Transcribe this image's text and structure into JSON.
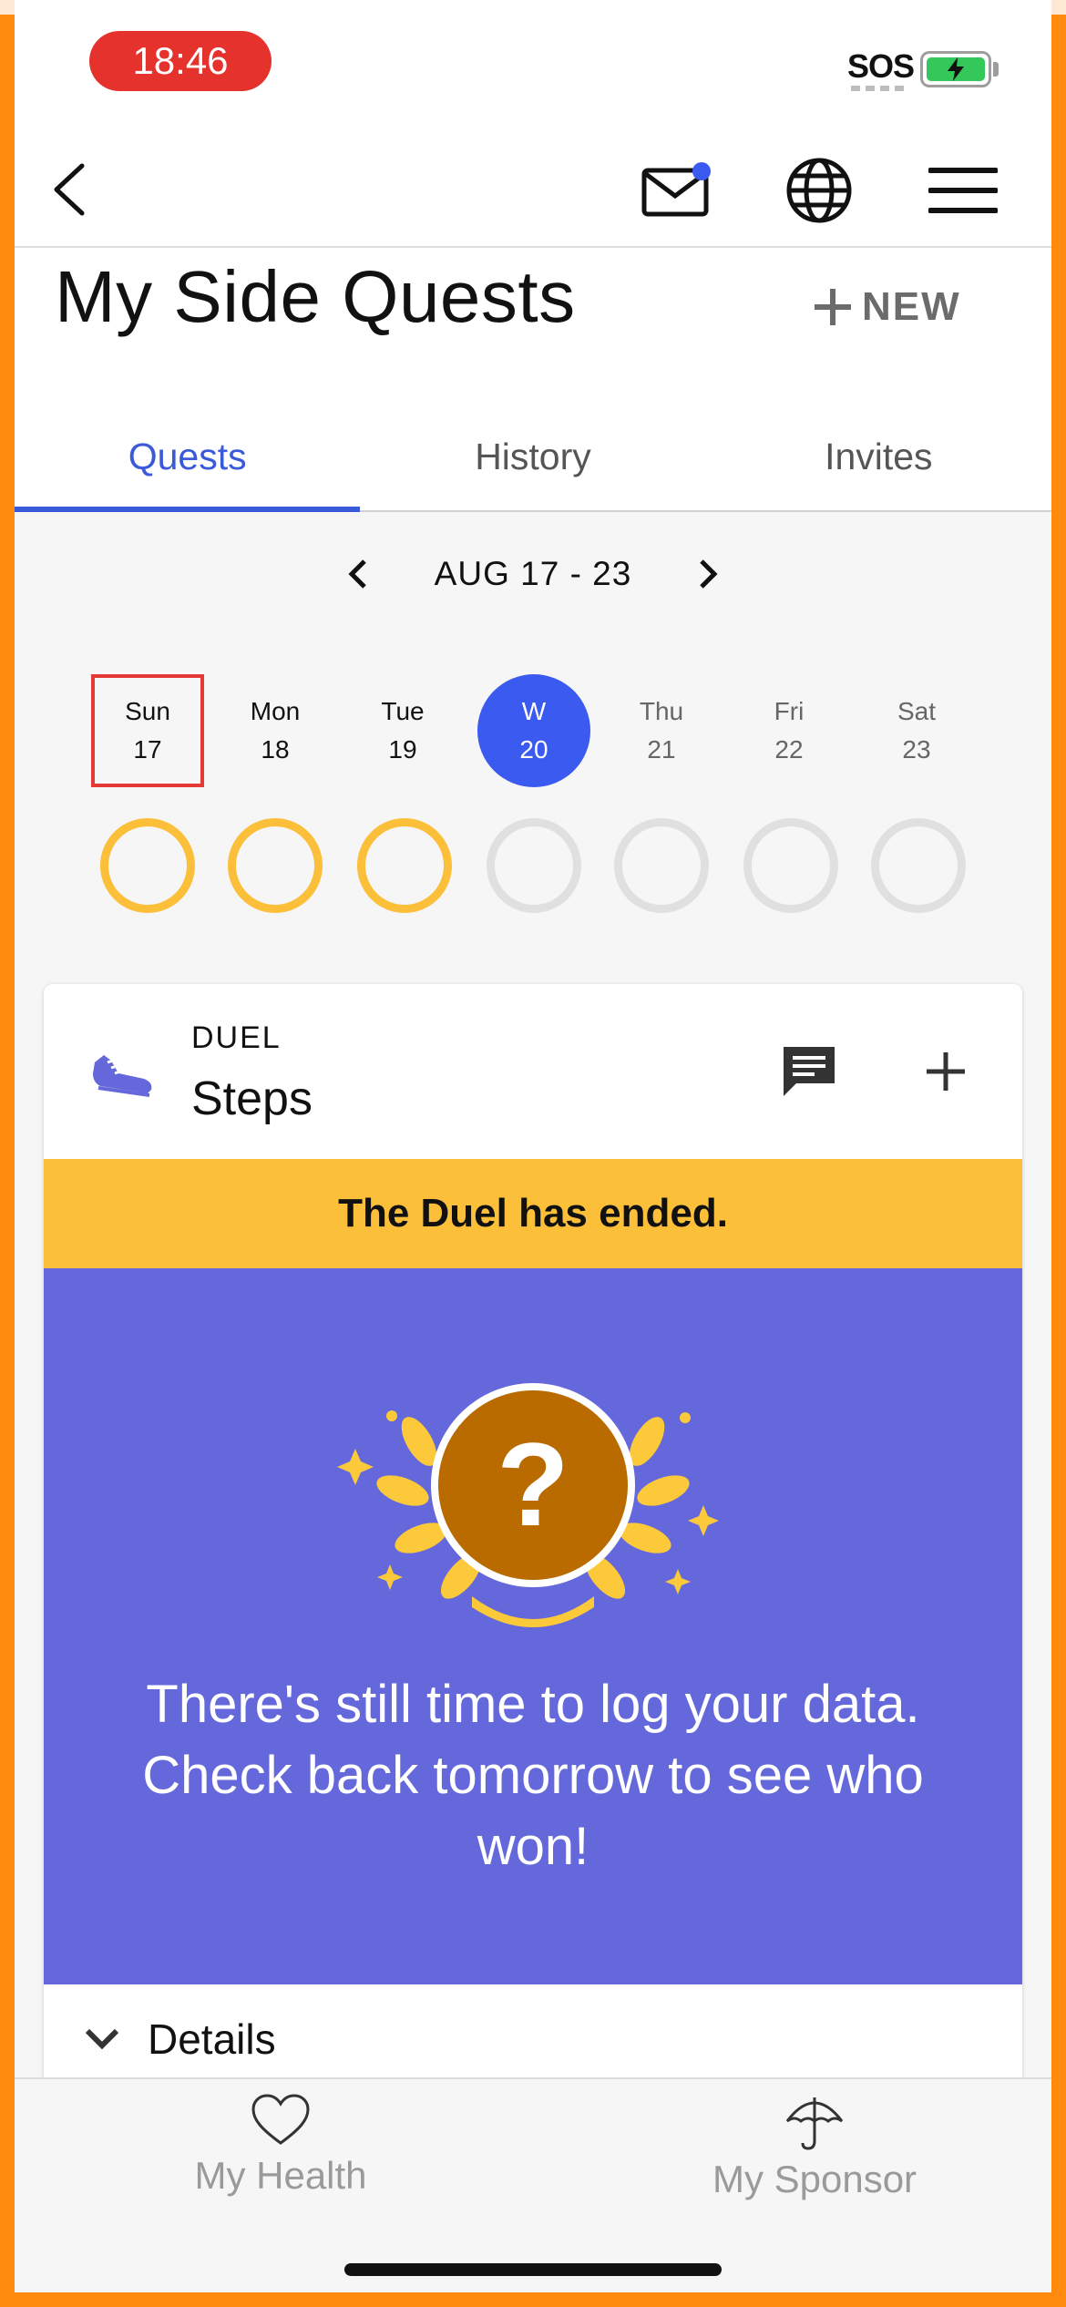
{
  "status_bar": {
    "time": "18:46",
    "sos": "SOS",
    "battery_state": "charging"
  },
  "nav": {
    "back_icon": "chevron-left-icon",
    "mail_icon": "mail-icon",
    "mail_has_badge": true,
    "globe_icon": "globe-icon",
    "menu_icon": "hamburger-menu-icon"
  },
  "header": {
    "title": "My Side Quests",
    "new_label": "NEW"
  },
  "tabs": [
    {
      "label": "Quests",
      "active": true
    },
    {
      "label": "History",
      "active": false
    },
    {
      "label": "Invites",
      "active": false
    }
  ],
  "week": {
    "range": "AUG 17 - 23",
    "days": [
      {
        "name": "Sun",
        "num": "17",
        "ring": "done"
      },
      {
        "name": "Mon",
        "num": "18",
        "ring": "done"
      },
      {
        "name": "Tue",
        "num": "19",
        "ring": "done"
      },
      {
        "name": "W",
        "num": "20",
        "ring": "empty"
      },
      {
        "name": "Thu",
        "num": "21",
        "ring": "empty"
      },
      {
        "name": "Fri",
        "num": "22",
        "ring": "empty"
      },
      {
        "name": "Sat",
        "num": "23",
        "ring": "empty"
      }
    ]
  },
  "card": {
    "kind": "DUEL",
    "title": "Steps",
    "banner": "The Duel has ended.",
    "trophy_mark": "?",
    "message": "There's still time to log your data. Check back tomorrow to see who won!",
    "details_label": "Details"
  },
  "bottom_tabs": [
    {
      "label": "My Health",
      "icon": "heart-icon"
    },
    {
      "label": "My Sponsor",
      "icon": "umbrella-icon"
    }
  ],
  "colors": {
    "accent": "#3a5ad9",
    "today": "#3a5af0",
    "gold": "#fbbf3a",
    "panel": "#6468db",
    "frame": "#ff8a0d"
  }
}
